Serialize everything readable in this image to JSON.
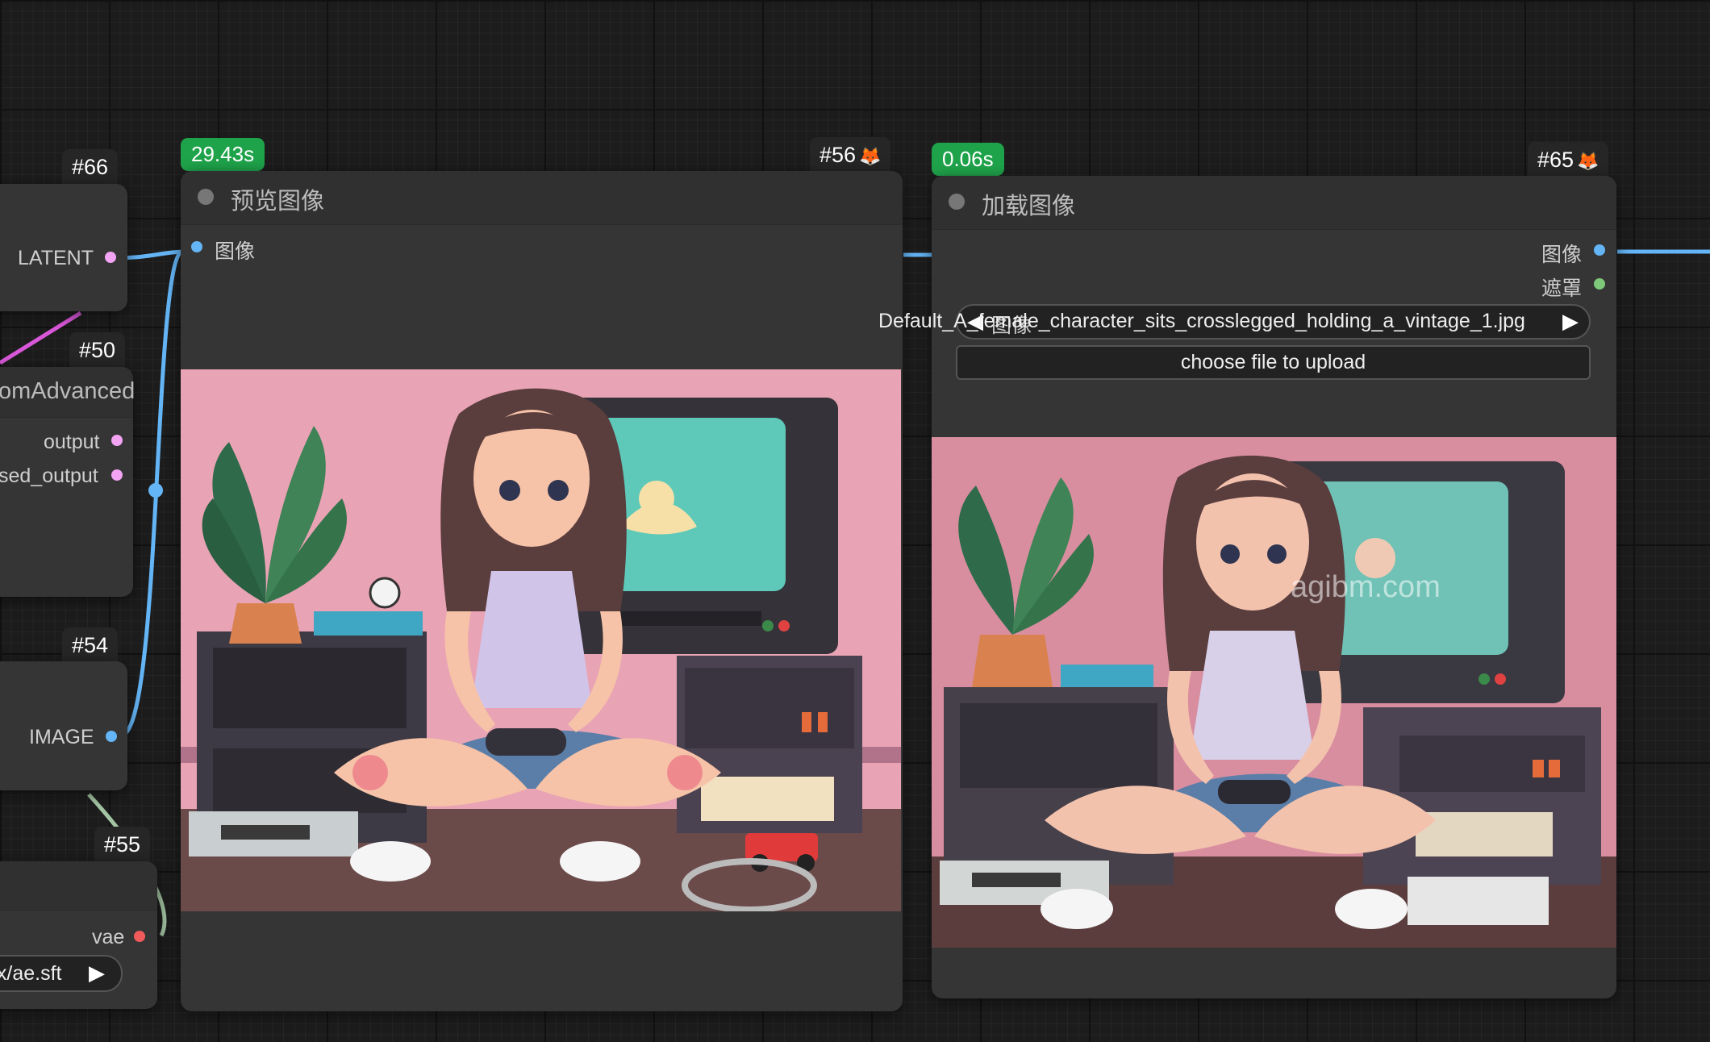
{
  "colors": {
    "canvas_bg": "#1c1c1c",
    "node_bg": "#353535",
    "badge_green": "#1fa34a",
    "link_blue": "#64b5f6",
    "link_pink": "#d957d9",
    "link_gray": "#a3c4a3"
  },
  "left_nodes": {
    "n66": {
      "id": "#66",
      "output_label": "LATENT"
    },
    "n50": {
      "id": "#50",
      "title": "omAdvanced",
      "outputs": [
        "output",
        "sed_output"
      ]
    },
    "n54": {
      "id": "#54",
      "output_label": "IMAGE"
    },
    "n55": {
      "id": "#55",
      "output_label": "vae",
      "widget_value": "ux/ae.sft"
    }
  },
  "preview_node": {
    "id": "#56",
    "icon": "fox-icon",
    "exec_time": "29.43s",
    "title": "预览图像",
    "input_label": "图像"
  },
  "load_node": {
    "id": "#65",
    "icon": "fox-icon",
    "exec_time": "0.06s",
    "title": "加载图像",
    "outputs": [
      "图像",
      "遮罩"
    ],
    "widget_label": "图像",
    "file_value": "Default_A_female_character_sits_crosslegged_holding_a_vintage_1.jpg",
    "upload_label": "choose file to upload",
    "watermark": "agibm.com"
  }
}
